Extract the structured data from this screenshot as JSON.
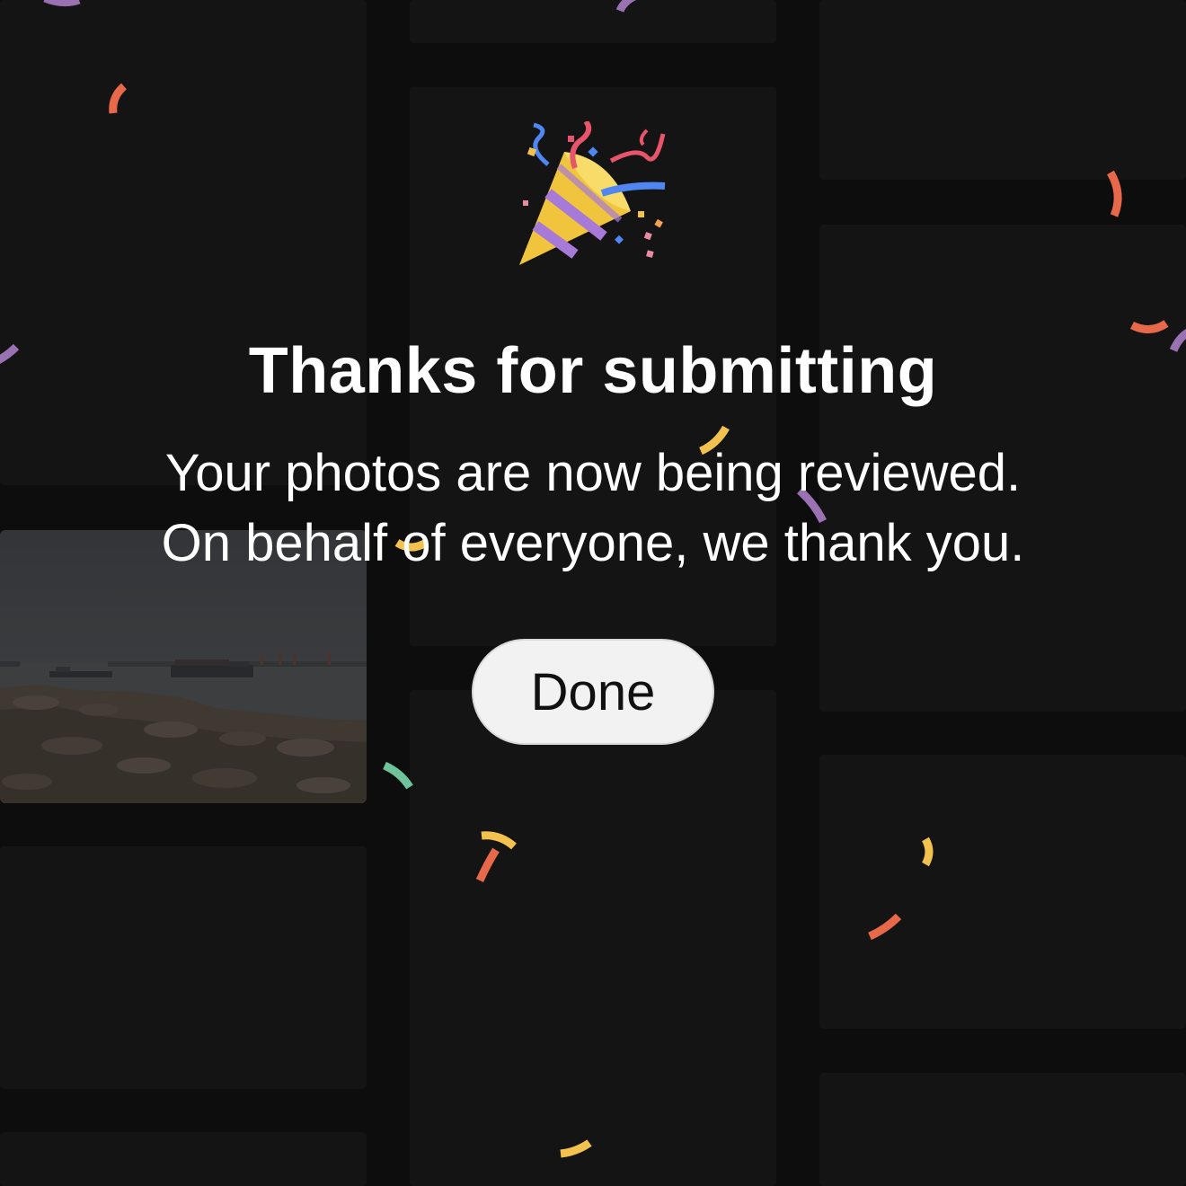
{
  "dialog": {
    "icon": "party-popper-icon",
    "title": "Thanks for submitting",
    "message_line1": "Your photos are now being reviewed.",
    "message_line2": "On behalf of everyone, we thank you.",
    "done_label": "Done"
  },
  "colors": {
    "background": "#131313",
    "tile": "#1d1d1d",
    "title_text": "#ffffff",
    "button_bg": "#f2f2f2",
    "button_text": "#111111",
    "confetti_orange": "#e8684a",
    "confetti_yellow": "#f2c14e",
    "confetti_purple": "#9a72b4",
    "confetti_green": "#6fc39a"
  }
}
